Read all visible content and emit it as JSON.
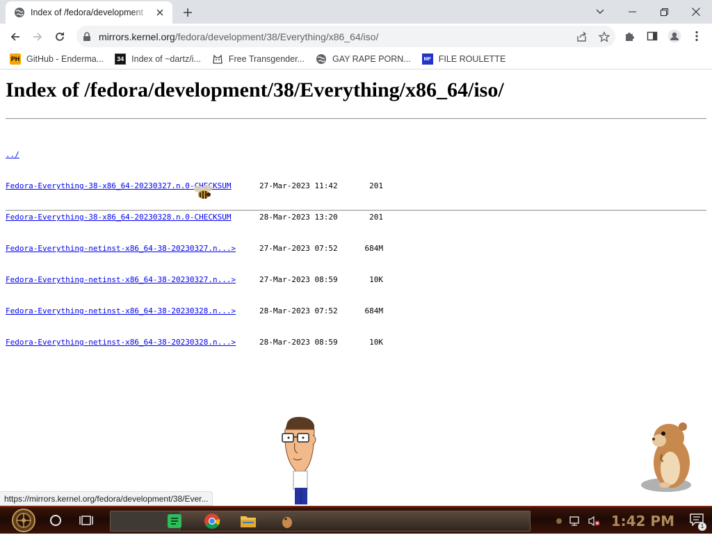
{
  "tab": {
    "title": "Index of /fedora/development",
    "close_label": "×"
  },
  "window": {
    "new_tab": "+"
  },
  "omnibox": {
    "host": "mirrors.kernel.org",
    "path": "/fedora/development/38/Everything/x86_64/iso/"
  },
  "bookmarks": [
    {
      "label": "GitHub - Enderma...",
      "icon": "ph-favicon",
      "icon_text": "PH"
    },
    {
      "label": "Index of ~dartz/i...",
      "icon": "dartz-favicon",
      "icon_text": "34"
    },
    {
      "label": "Free Transgender...",
      "icon": "cat-favicon",
      "icon_text": ""
    },
    {
      "label": "GAY RAPE PORN...",
      "icon": "globe-icon",
      "icon_text": ""
    },
    {
      "label": "FILE ROULETTE",
      "icon": "mf-favicon",
      "icon_text": "MF"
    }
  ],
  "page": {
    "title": "Index of /fedora/development/38/Everything/x86_64/iso/",
    "parent_link": "../",
    "files": [
      {
        "name": "Fedora-Everything-38-x86_64-20230327.n.0-CHECKSUM",
        "date": "27-Mar-2023 11:42",
        "size": "201"
      },
      {
        "name": "Fedora-Everything-38-x86_64-20230328.n.0-CHECKSUM",
        "date": "28-Mar-2023 13:20",
        "size": "201"
      },
      {
        "name": "Fedora-Everything-netinst-x86_64-38-20230327.n...>",
        "date": "27-Mar-2023 07:52",
        "size": "684M"
      },
      {
        "name": "Fedora-Everything-netinst-x86_64-38-20230327.n...>",
        "date": "27-Mar-2023 08:59",
        "size": "10K"
      },
      {
        "name": "Fedora-Everything-netinst-x86_64-38-20230328.n...>",
        "date": "28-Mar-2023 07:52",
        "size": "684M"
      },
      {
        "name": "Fedora-Everything-netinst-x86_64-38-20230328.n...>",
        "date": "28-Mar-2023 08:59",
        "size": "10K"
      }
    ]
  },
  "statusbar": {
    "text": "https://mirrors.kernel.org/fedora/development/38/Ever..."
  },
  "taskbar": {
    "clock": "1:42 PM",
    "notification_count": "1"
  },
  "colors": {
    "link": "#0000ee",
    "tabstrip": "#dee1e6",
    "taskbar": "#2a0d06",
    "clock": "#b08a5a"
  }
}
